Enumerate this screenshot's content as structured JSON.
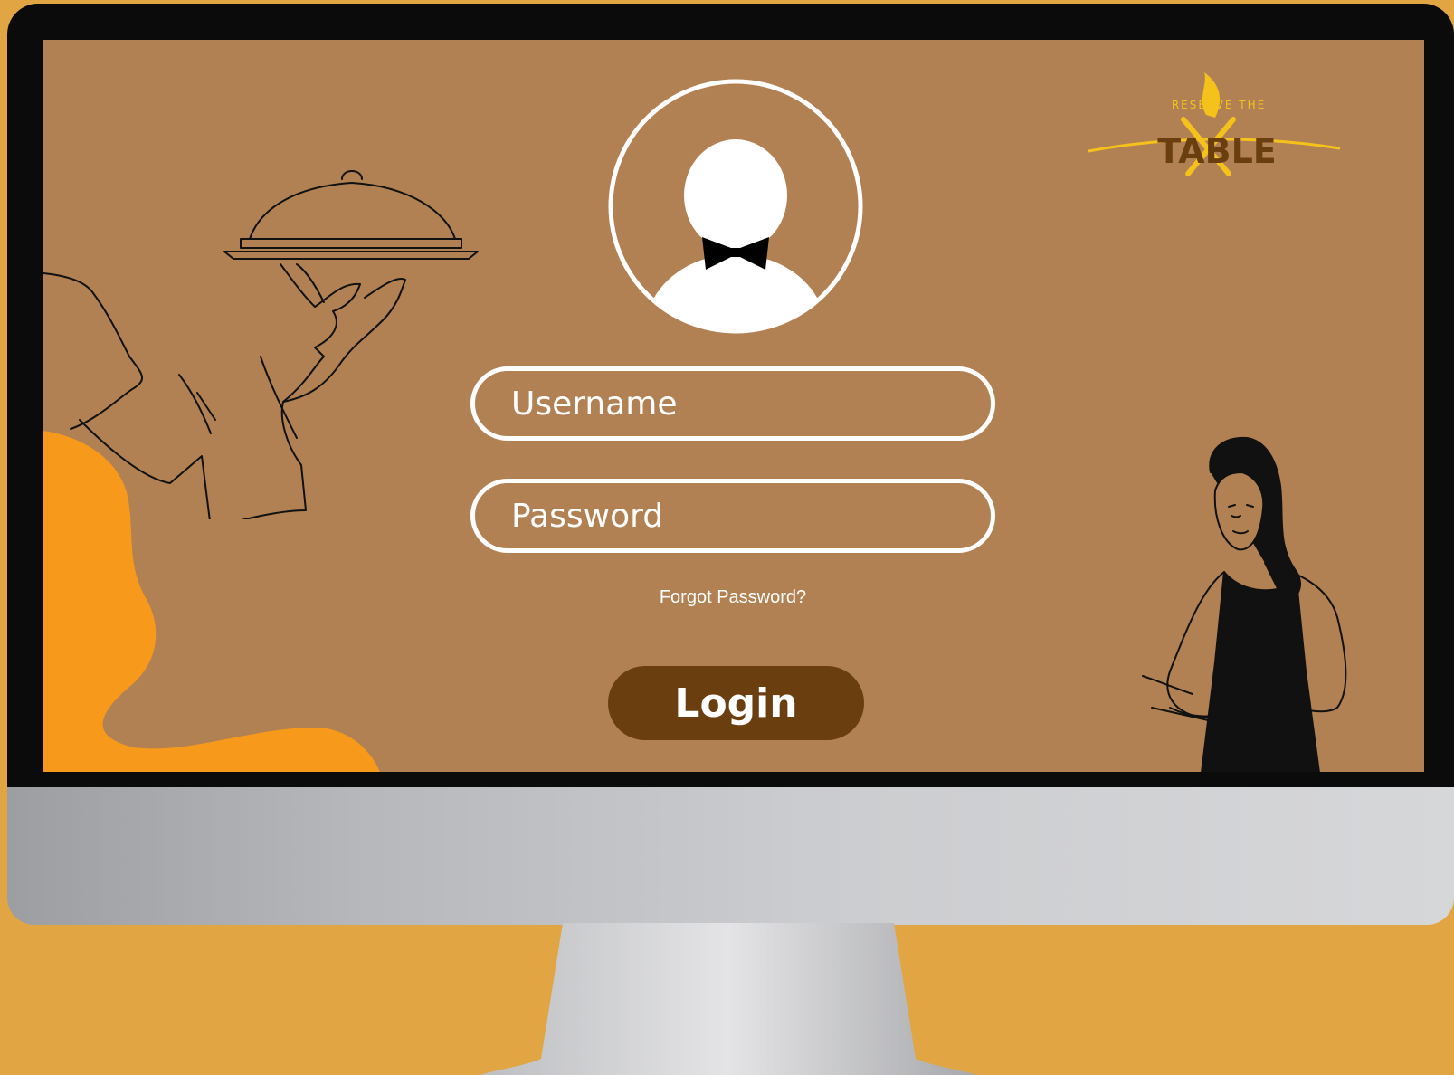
{
  "brand": {
    "logo_small_text": "RESERVE THE",
    "logo_main_text": "TABLE"
  },
  "login_form": {
    "username_placeholder": "Username",
    "password_placeholder": "Password",
    "forgot_password_label": "Forgot Password?",
    "login_button_label": "Login"
  },
  "colors": {
    "page_background": "#E2A543",
    "screen_background": "#B28153",
    "login_button": "#6B3E10",
    "accent_blob": "#F7991B",
    "logo_yellow": "#F4C21B"
  },
  "icons": {
    "avatar": "user-avatar-with-bowtie-icon",
    "waiter_hand": "serving-tray-hand-illustration",
    "waitress": "waitress-illustration"
  }
}
